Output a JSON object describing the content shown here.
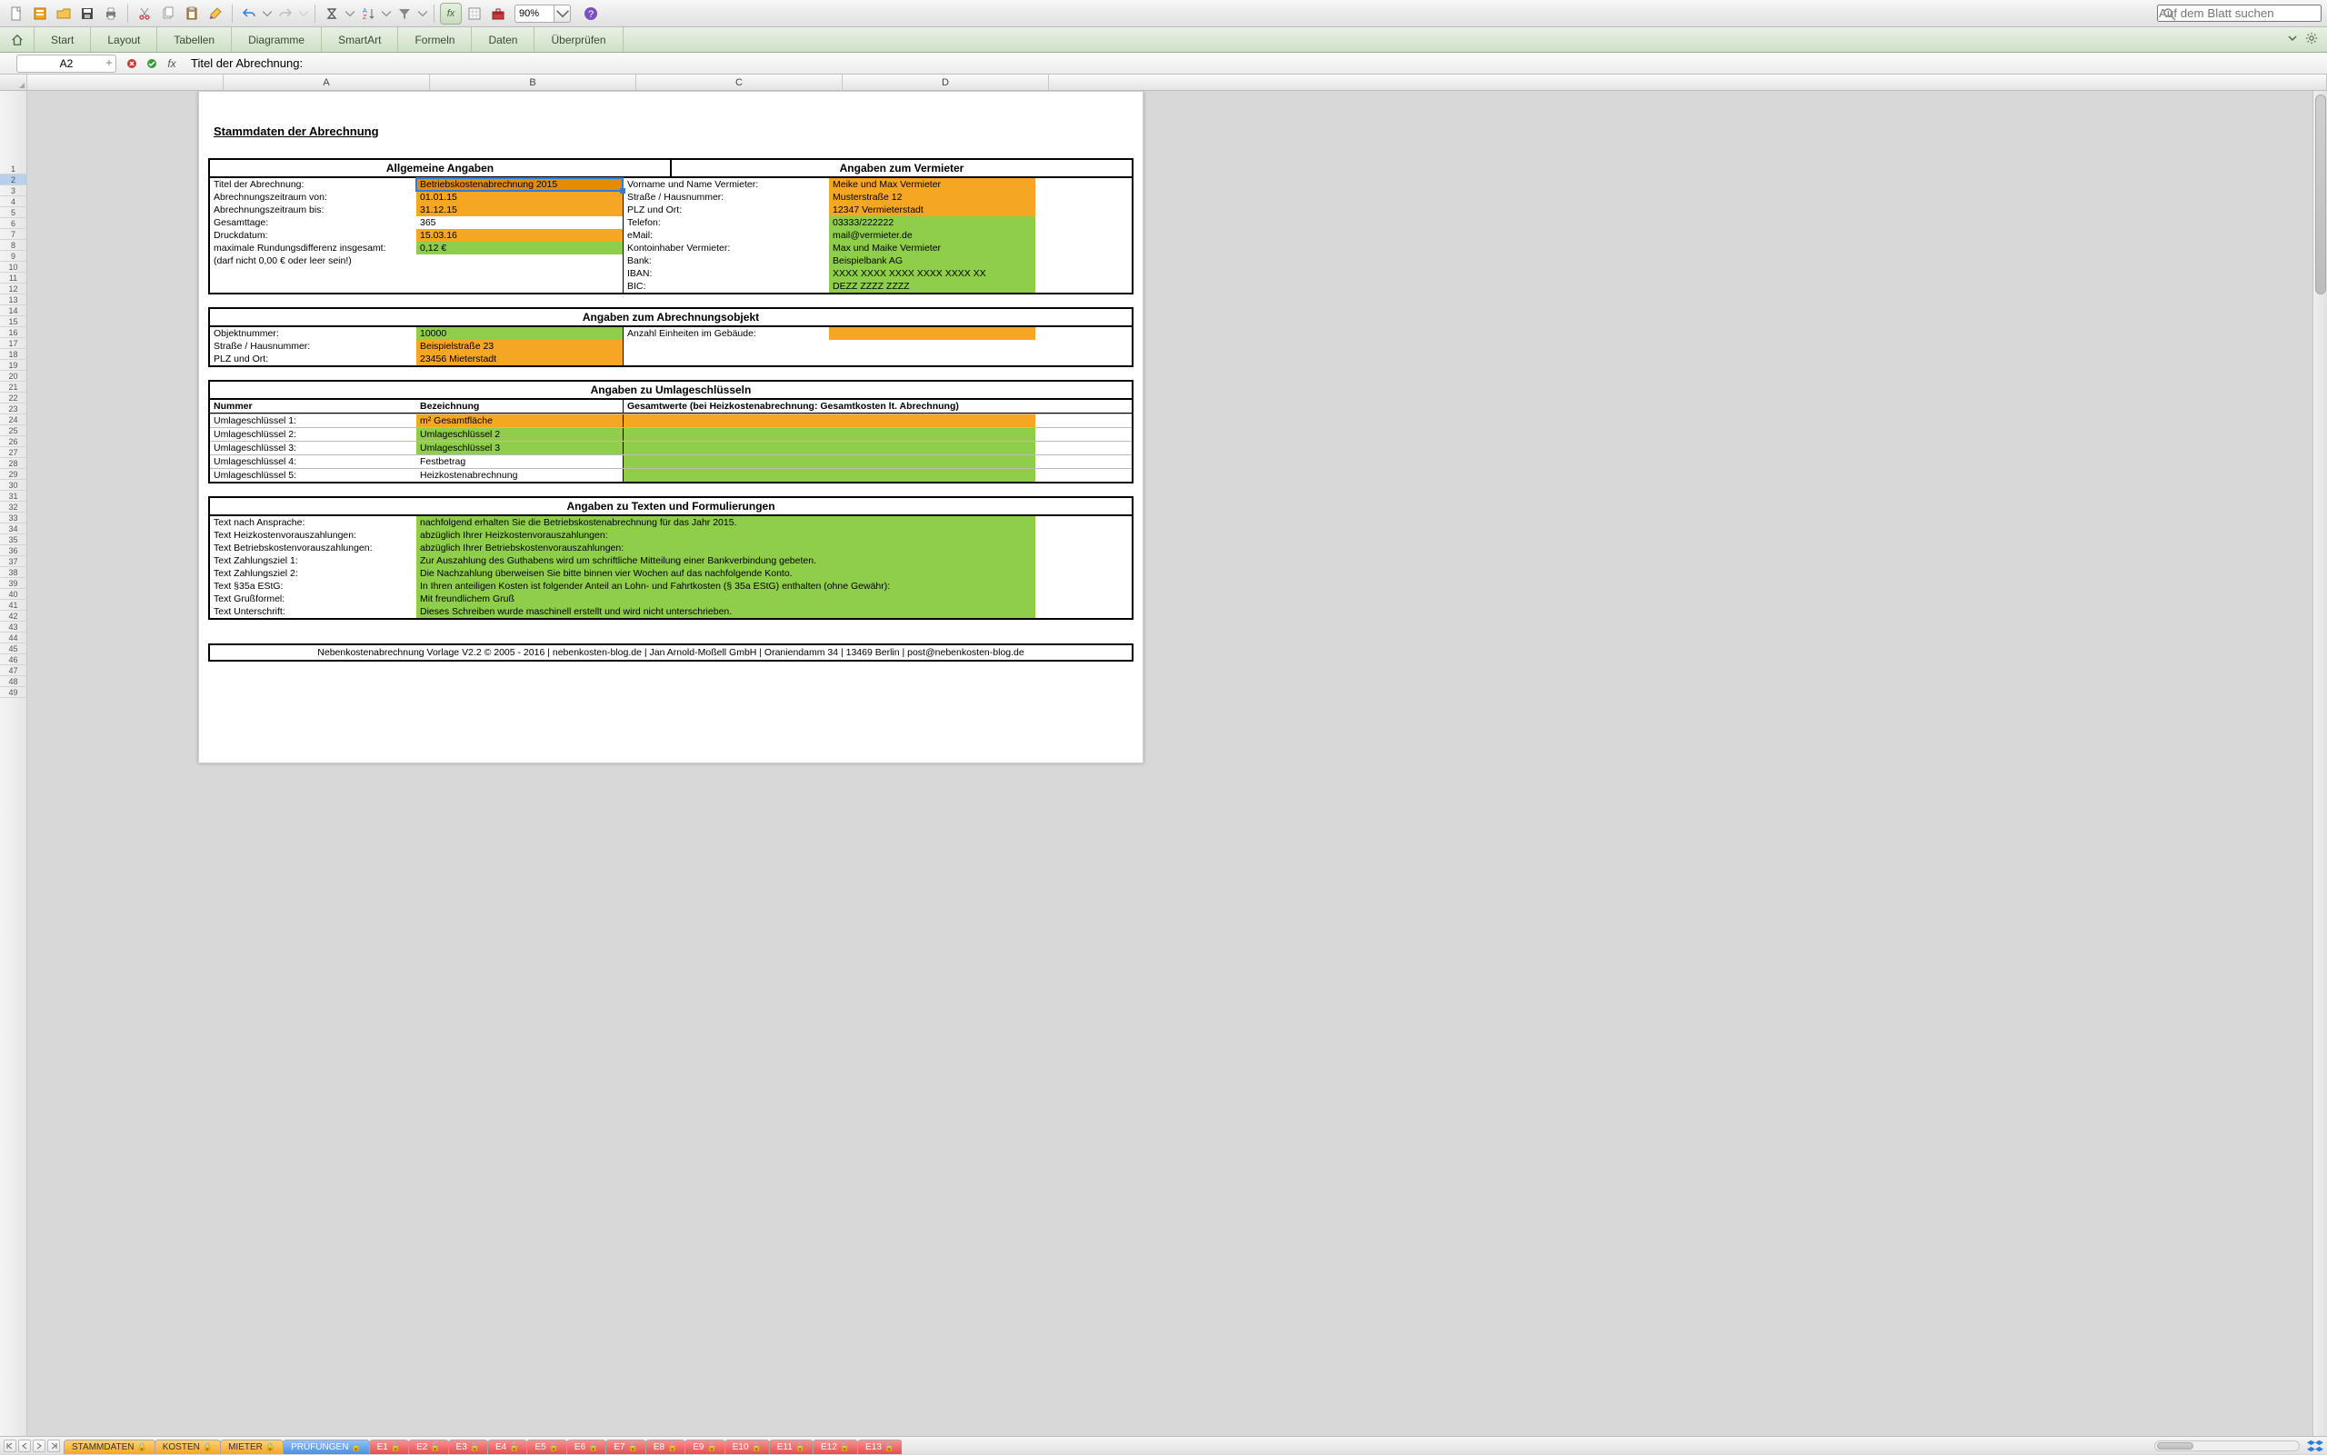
{
  "toolbar": {
    "zoom": "90%",
    "search_placeholder": "Auf dem Blatt suchen"
  },
  "ribbon": {
    "tabs": [
      "Start",
      "Layout",
      "Tabellen",
      "Diagramme",
      "SmartArt",
      "Formeln",
      "Daten",
      "Überprüfen"
    ]
  },
  "formula": {
    "name_box": "A2",
    "value": "Titel der Abrechnung:"
  },
  "columns": [
    "A",
    "B",
    "C",
    "D"
  ],
  "row_numbers_start": 1,
  "row_numbers_end": 49,
  "selected_row": 2,
  "doc": {
    "title": "Stammdaten der Abrechnung",
    "section1": {
      "left_head": "Allgemeine Angaben",
      "right_head": "Angaben zum Vermieter",
      "left": [
        {
          "label": "Titel der Abrechnung:",
          "value": "Betriebskostenabrechnung 2015",
          "cls": "dorange",
          "sel": true
        },
        {
          "label": "Abrechnungszeitraum von:",
          "value": "01.01.15",
          "cls": "orange"
        },
        {
          "label": "Abrechnungszeitraum bis:",
          "value": "31.12.15",
          "cls": "orange"
        },
        {
          "label": "Gesamttage:",
          "value": "365",
          "cls": ""
        },
        {
          "label": "Druckdatum:",
          "value": "15.03.16",
          "cls": "orange"
        },
        {
          "label": "maximale Rundungsdifferenz insgesamt:",
          "value": "0,12 €",
          "cls": "green"
        },
        {
          "label": "(darf nicht 0,00 € oder leer sein!)",
          "value": "",
          "cls": ""
        }
      ],
      "right": [
        {
          "label": "Vorname und Name Vermieter:",
          "value": "Meike und Max Vermieter",
          "cls": "orange"
        },
        {
          "label": "Straße / Hausnummer:",
          "value": "Musterstraße 12",
          "cls": "orange"
        },
        {
          "label": "PLZ und Ort:",
          "value": "12347 Vermieterstadt",
          "cls": "orange"
        },
        {
          "label": "Telefon:",
          "value": "03333/222222",
          "cls": "green"
        },
        {
          "label": "eMail:",
          "value": "mail@vermieter.de",
          "cls": "green"
        },
        {
          "label": "Kontoinhaber Vermieter:",
          "value": "Max und Maike Vermieter",
          "cls": "green"
        },
        {
          "label": "Bank:",
          "value": "Beispielbank AG",
          "cls": "green"
        },
        {
          "label": "IBAN:",
          "value": "XXXX XXXX XXXX XXXX XXXX XX",
          "cls": "green"
        },
        {
          "label": "BIC:",
          "value": "DEZZ ZZZZ ZZZZ",
          "cls": "green"
        }
      ]
    },
    "section2": {
      "head": "Angaben zum Abrechnungsobjekt",
      "left": [
        {
          "label": "Objektnummer:",
          "value": "10000",
          "cls": "green"
        },
        {
          "label": "Straße / Hausnummer:",
          "value": "Beispielstraße 23",
          "cls": "orange"
        },
        {
          "label": "PLZ und Ort:",
          "value": "23456 Mieterstadt",
          "cls": "orange"
        }
      ],
      "right_label": "Anzahl Einheiten im Gebäude:",
      "right_value": ""
    },
    "section3": {
      "head": "Angaben zu Umlageschlüsseln",
      "colhead": {
        "a": "Nummer",
        "b": "Bezeichnung",
        "c": "Gesamtwerte (bei Heizkostenabrechnung: Gesamtkosten lt. Abrechnung)"
      },
      "rows": [
        {
          "num": "Umlageschlüssel 1:",
          "bez": "m² Gesamtfläche",
          "cls": "orange",
          "rcl": "orange"
        },
        {
          "num": "Umlageschlüssel 2:",
          "bez": "Umlageschlüssel 2",
          "cls": "green",
          "rcl": "green"
        },
        {
          "num": "Umlageschlüssel 3:",
          "bez": "Umlageschlüssel 3",
          "cls": "green",
          "rcl": "green"
        },
        {
          "num": "Umlageschlüssel 4:",
          "bez": "Festbetrag",
          "cls": "",
          "rcl": "green"
        },
        {
          "num": "Umlageschlüssel 5:",
          "bez": "Heizkostenabrechnung",
          "cls": "",
          "rcl": "green"
        }
      ]
    },
    "section4": {
      "head": "Angaben zu Texten und Formulierungen",
      "rows": [
        {
          "label": "Text nach Ansprache:",
          "value": "nachfolgend erhalten Sie die Betriebskostenabrechnung für das Jahr 2015."
        },
        {
          "label": "Text Heizkostenvorauszahlungen:",
          "value": "abzüglich Ihrer Heizkostenvorauszahlungen:"
        },
        {
          "label": "Text Betriebskostenvorauszahlungen:",
          "value": "abzüglich Ihrer Betriebskostenvorauszahlungen:"
        },
        {
          "label": "Text Zahlungsziel 1:",
          "value": "Zur Auszahlung des Guthabens wird um schriftliche Mitteilung einer Bankverbindung gebeten."
        },
        {
          "label": "Text Zahlungsziel 2:",
          "value": "Die Nachzahlung überweisen Sie bitte binnen vier Wochen auf das nachfolgende Konto."
        },
        {
          "label": "Text §35a EStG:",
          "value": "In Ihren anteiligen Kosten ist folgender Anteil an Lohn- und Fahrtkosten (§ 35a EStG) enthalten (ohne Gewähr):"
        },
        {
          "label": "Text Grußformel:",
          "value": "Mit freundlichem Gruß"
        },
        {
          "label": "Text Unterschrift:",
          "value": "Dieses Schreiben wurde maschinell erstellt und wird nicht unterschrieben."
        }
      ]
    },
    "footer": "Nebenkostenabrechnung Vorlage V2.2 © 2005 - 2016 | nebenkosten-blog.de | Jan Arnold-Moßell GmbH | Oraniendamm 34 | 13469 Berlin | post@nebenkosten-blog.de"
  },
  "sheets": {
    "orange": [
      "STAMMDATEN",
      "KOSTEN",
      "MIETER"
    ],
    "blue": [
      "PRÜFUNGEN"
    ],
    "red": [
      "E1",
      "E2",
      "E3",
      "E4",
      "E5",
      "E6",
      "E7",
      "E8",
      "E9",
      "E10",
      "E11",
      "E12",
      "E13"
    ]
  }
}
